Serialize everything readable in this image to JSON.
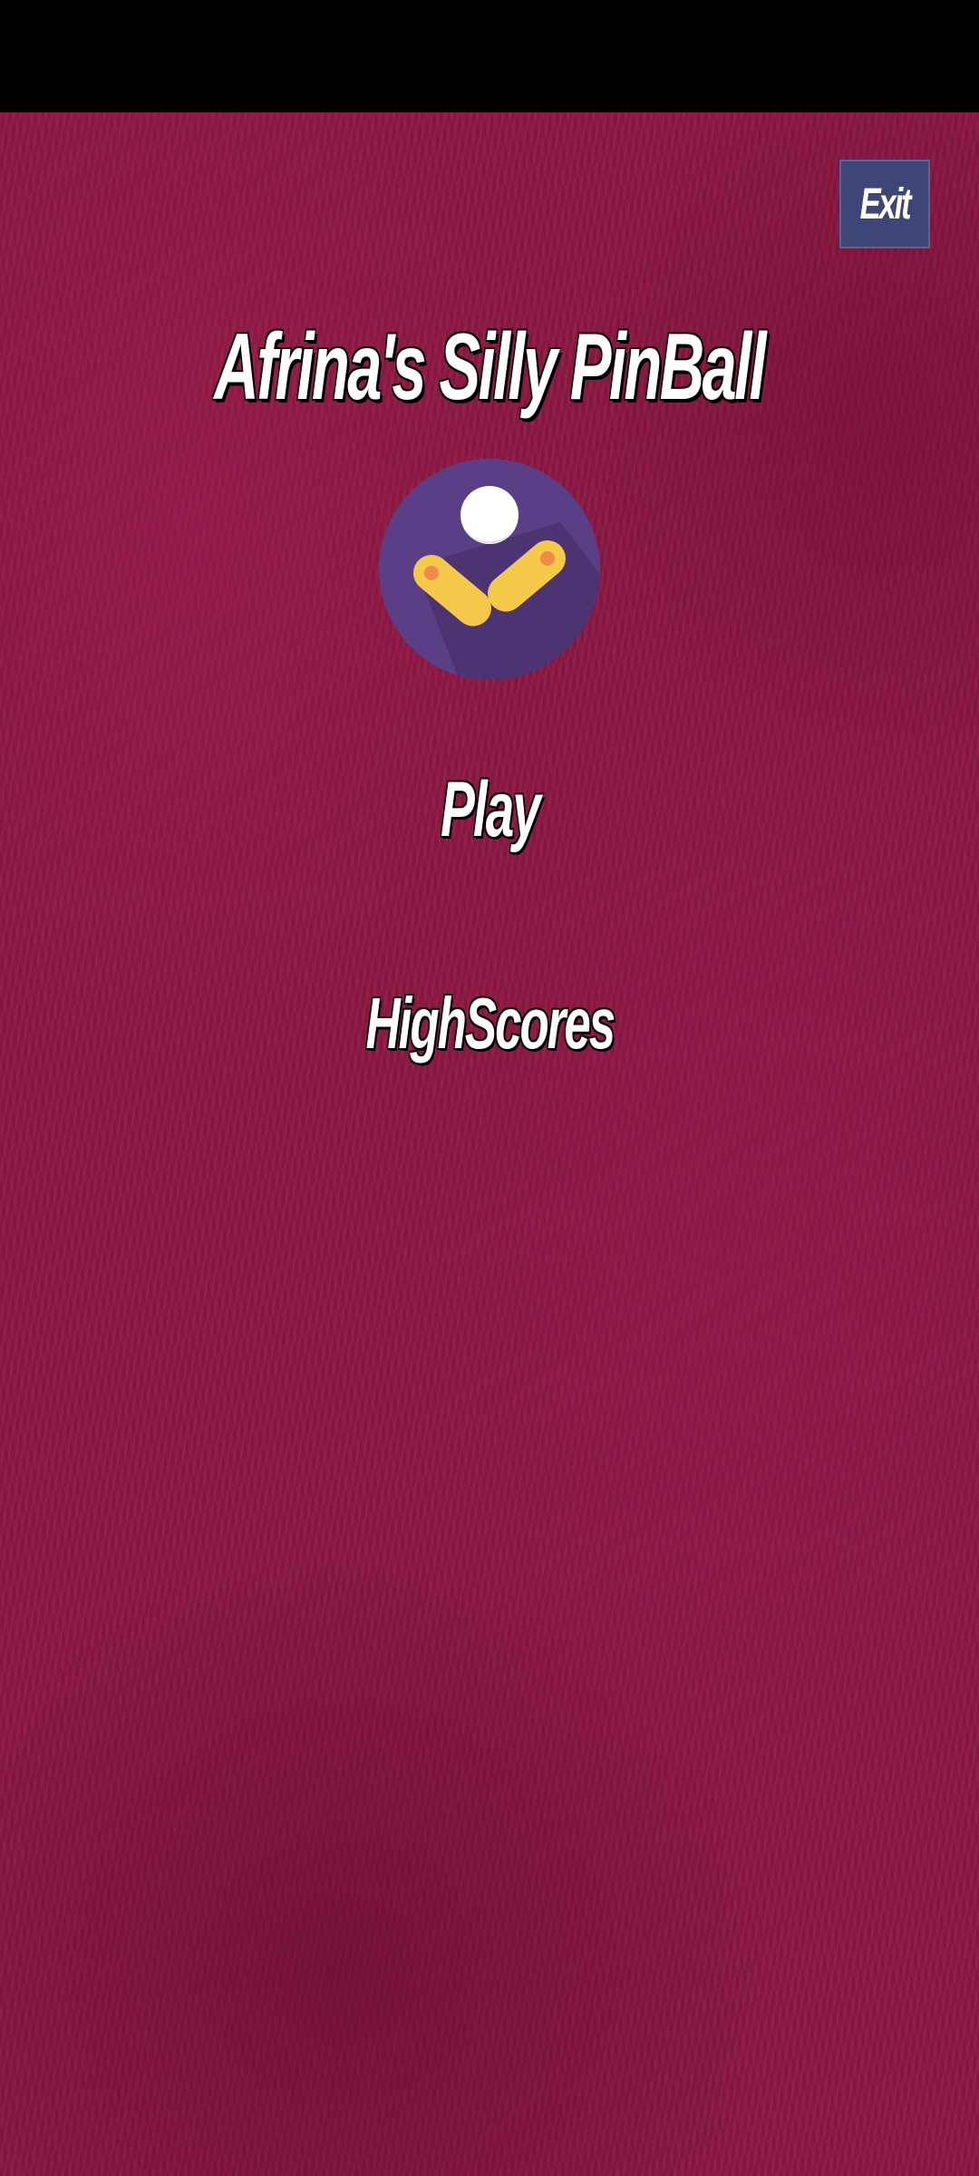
{
  "app": {
    "title": "Afrina's Silly PinBall"
  },
  "header": {
    "exit_label": "Exit"
  },
  "menu": {
    "play_label": "Play",
    "highscores_label": "HighScores"
  },
  "icons": {
    "logo": "pinball-flippers-icon"
  },
  "colors": {
    "background": "#8a1742",
    "status_bar": "#000000",
    "exit_button": "#3e4677",
    "logo_circle": "#5a3f86",
    "flipper": "#f4c94a",
    "ball": "#ffffff"
  }
}
